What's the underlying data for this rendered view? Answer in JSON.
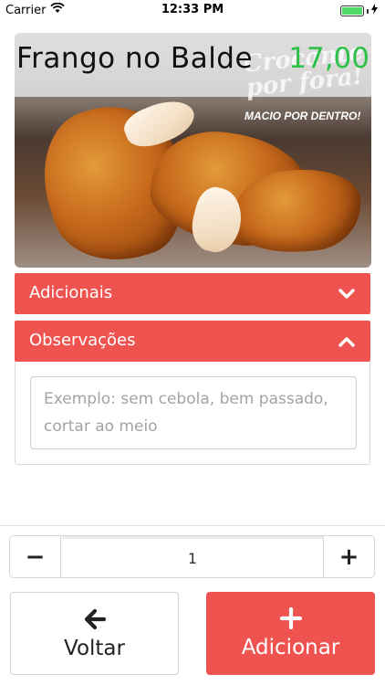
{
  "status_bar": {
    "carrier": "Carrier",
    "time": "12:33 PM",
    "battery_level": 1.0
  },
  "product": {
    "name": "Frango no Balde",
    "price": "17,00",
    "image_text": {
      "script": "Crocante por fora!",
      "tagline": "MACIO POR DENTRO!"
    }
  },
  "sections": {
    "adicionais": {
      "title": "Adicionais",
      "expanded": false
    },
    "observacoes": {
      "title": "Observações",
      "expanded": true,
      "input_value": "",
      "placeholder": "Exemplo: sem cebola, bem passado, cortar ao meio"
    }
  },
  "quantity": {
    "minus_label": "−",
    "value": "1",
    "plus_label": "+"
  },
  "actions": {
    "back_label": "Voltar",
    "add_label": "Adicionar"
  },
  "colors": {
    "accent": "#ef5350",
    "price": "#2ec14a"
  },
  "icons": {
    "status": [
      "wifi-icon",
      "battery-icon",
      "charging-icon"
    ],
    "adicionais": "chevron-down-icon",
    "observacoes": "chevron-up-icon",
    "back": "arrow-left-icon",
    "add": "plus-icon"
  }
}
